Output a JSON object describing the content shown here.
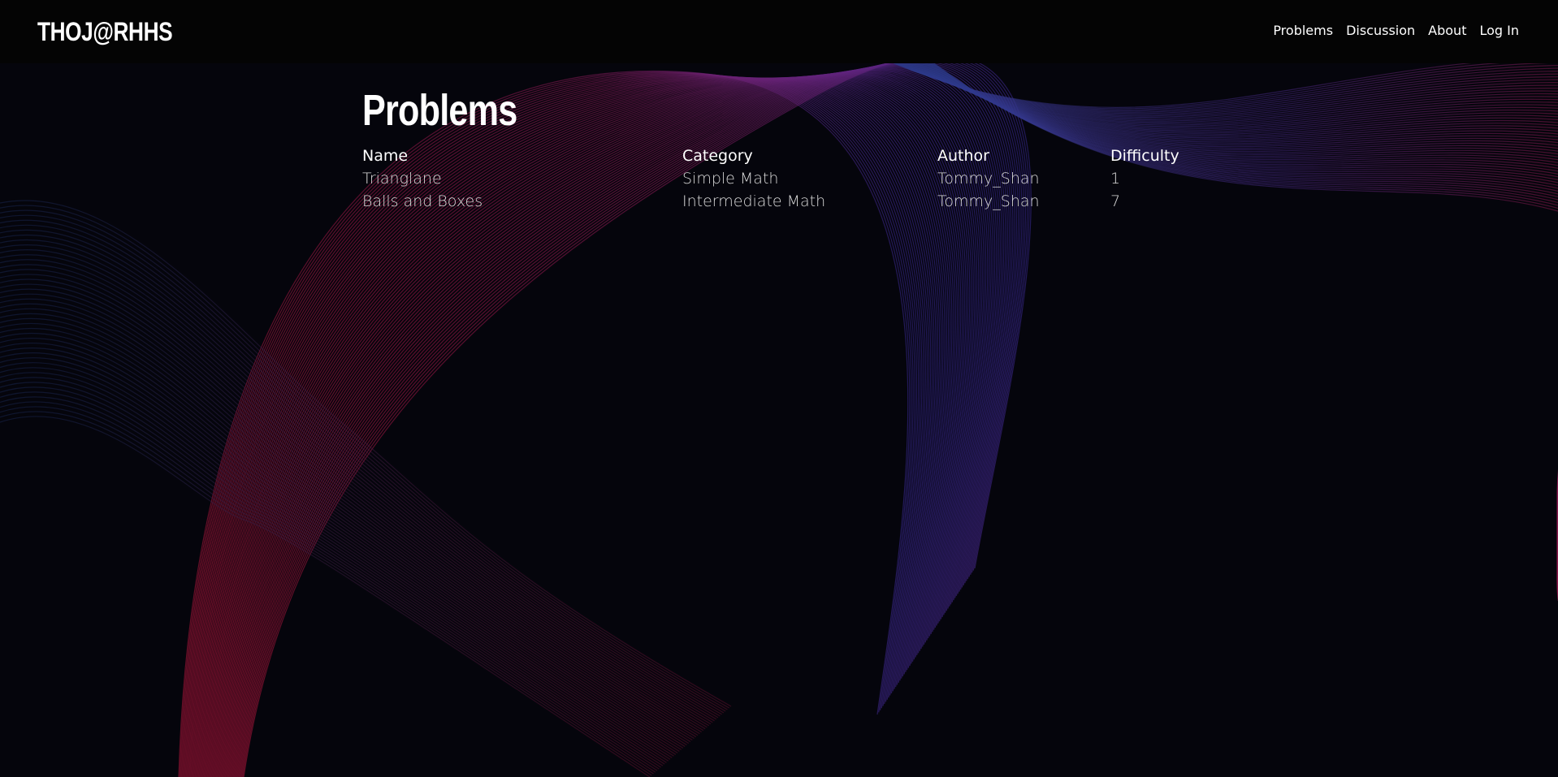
{
  "brand": "THOJ@RHHS",
  "nav": [
    {
      "label": "Problems"
    },
    {
      "label": "Discussion"
    },
    {
      "label": "About"
    },
    {
      "label": "Log In"
    }
  ],
  "page": {
    "title": "Problems"
  },
  "table": {
    "headers": [
      "Name",
      "Category",
      "Author",
      "Difficulty"
    ],
    "rows": [
      {
        "name": "Trianglane",
        "category": "Simple Math",
        "author": "Tommy_Shan",
        "difficulty": "1"
      },
      {
        "name": "Balls and Boxes",
        "category": "Intermediate Math",
        "author": "Tommy_Shan",
        "difficulty": "7"
      }
    ]
  },
  "colors": {
    "background": "#05050c",
    "navbar": "#040404",
    "wave_red": "#b0143a",
    "wave_blue": "#3a2a9a"
  }
}
